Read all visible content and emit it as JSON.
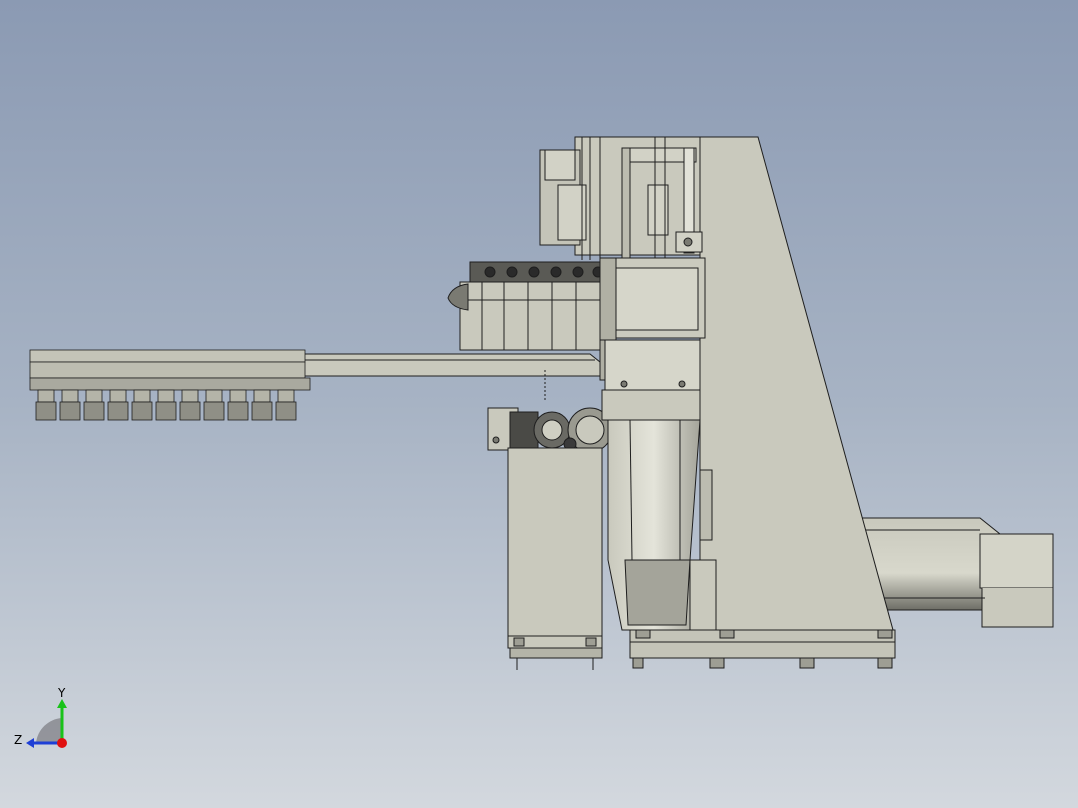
{
  "viewport": {
    "background_top": "#8b9ab3",
    "background_bottom": "#d3d8de"
  },
  "model": {
    "body_color": "#c9c9bd",
    "shade_color": "#9e9e94",
    "line_color": "#1e1e1e",
    "dark_part_color": "#3a3a3a"
  },
  "triad": {
    "y_label": "Y",
    "z_label": "Z",
    "y_color": "#19c219",
    "z_color": "#1e3fd6",
    "x_color": "#e01010"
  }
}
